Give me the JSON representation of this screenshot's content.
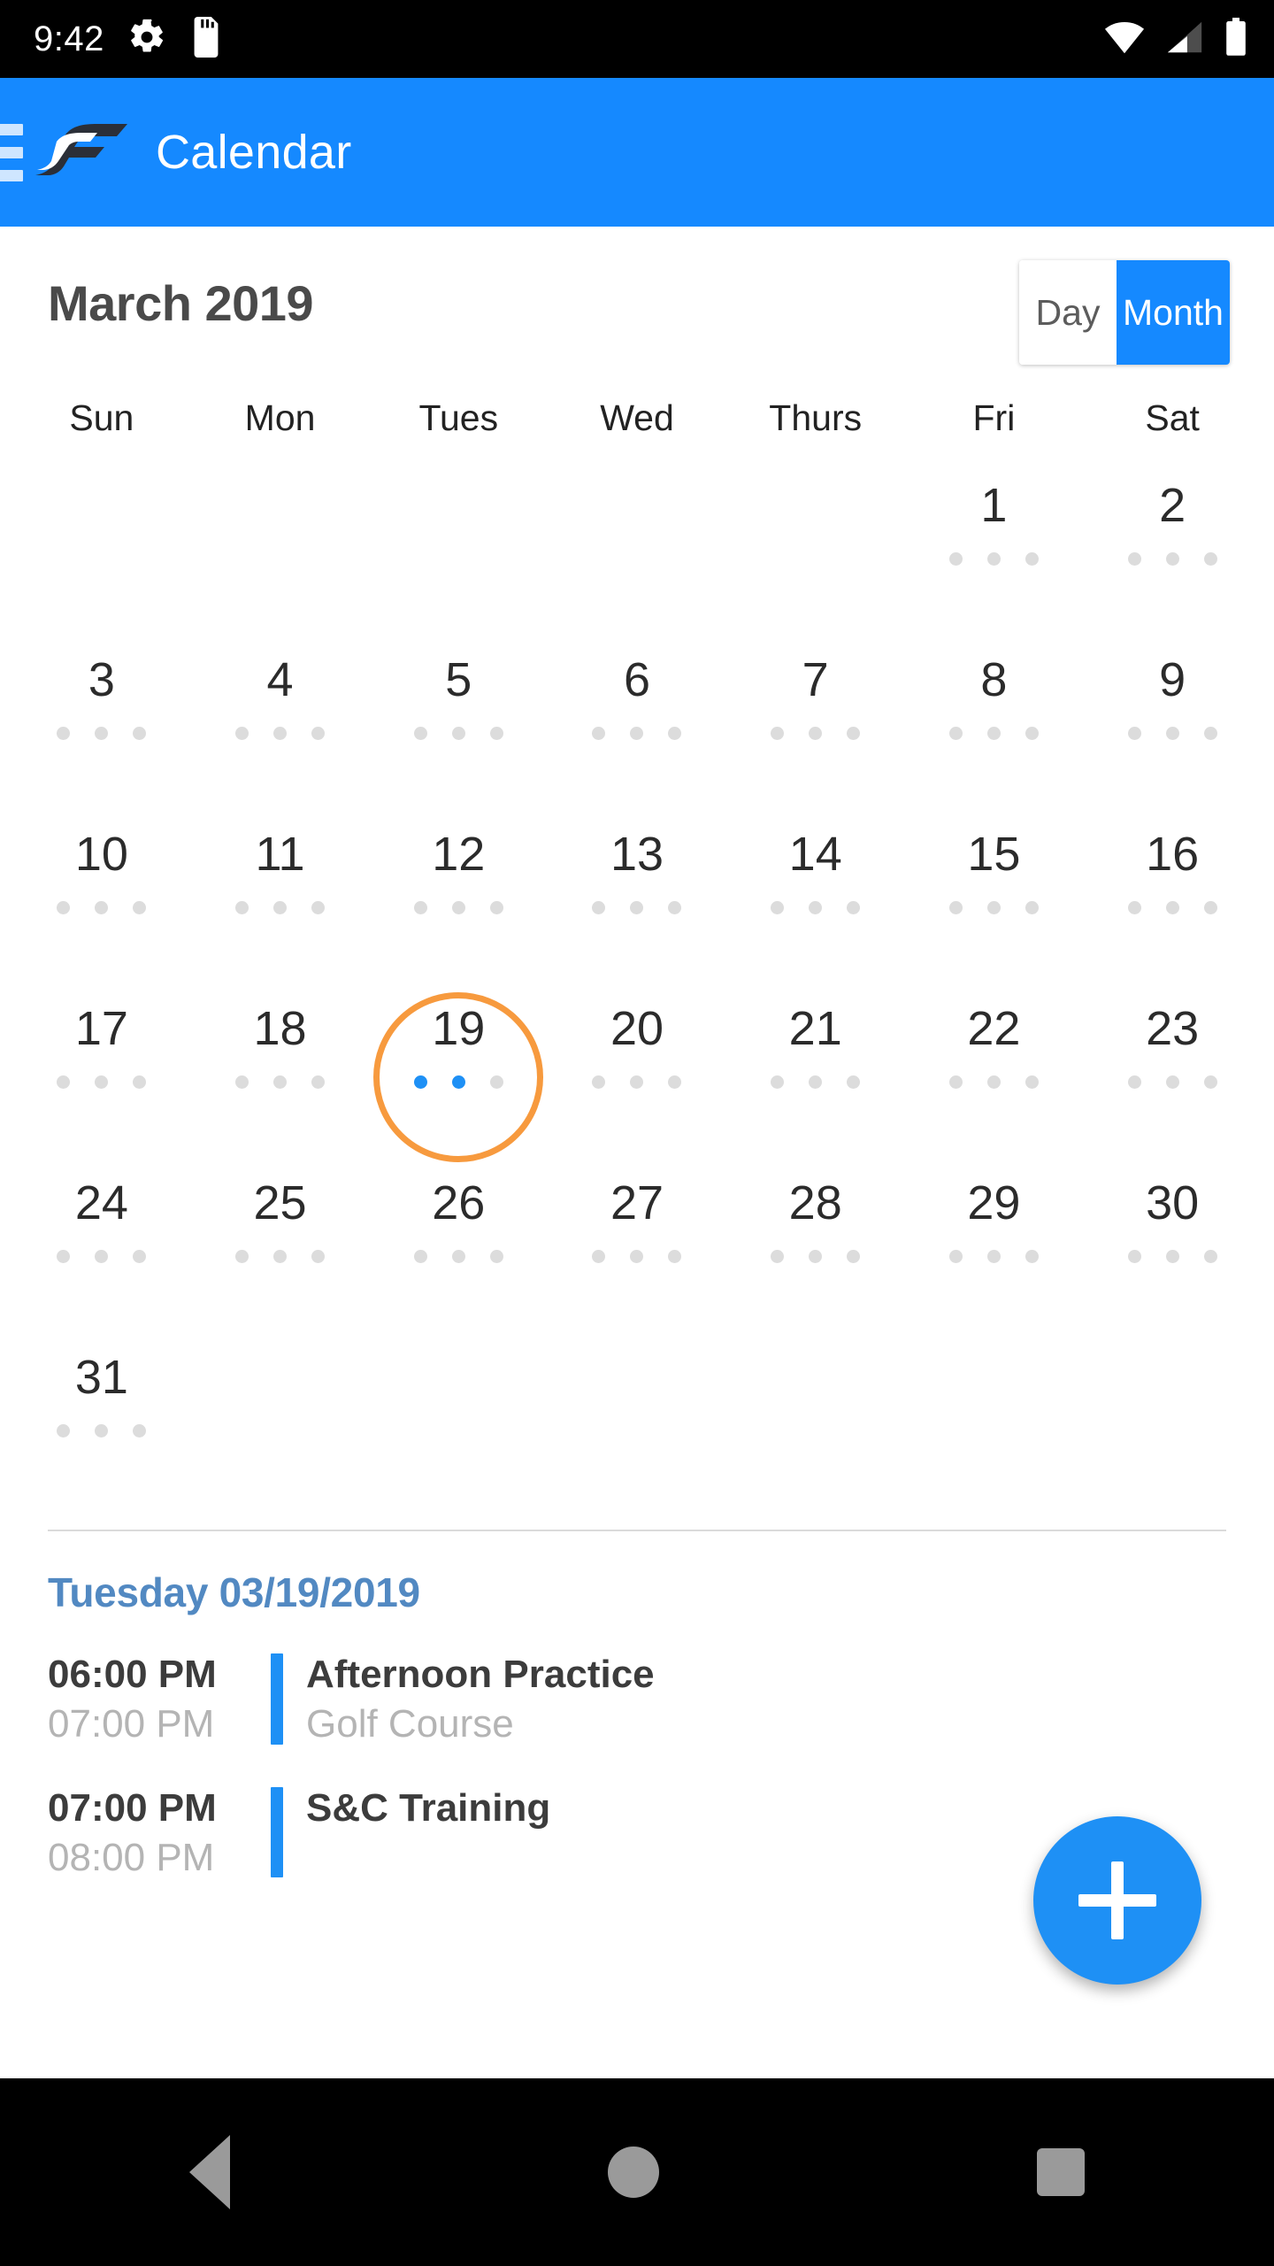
{
  "statusbar": {
    "time": "9:42",
    "icons": [
      "gear-icon",
      "sd-card-icon",
      "wifi-icon",
      "cellular-signal-icon",
      "battery-icon"
    ]
  },
  "appbar": {
    "menu_icon": "hamburger-menu-icon",
    "logo": "sf-logo",
    "title": "Calendar",
    "background_color": "#1589ff"
  },
  "header": {
    "month_title": "March 2019",
    "toggle": {
      "day_label": "Day",
      "month_label": "Month",
      "active": "Month",
      "active_color": "#1589ff"
    }
  },
  "calendar": {
    "weekdays": [
      "Sun",
      "Mon",
      "Tues",
      "Wed",
      "Thurs",
      "Fri",
      "Sat"
    ],
    "leading_blanks": 5,
    "selected_day": 19,
    "selection_ring_color": "#f79a3e",
    "event_dot_color": "#1e90f5",
    "empty_dot_color": "#dcdcdc",
    "days": [
      {
        "day": "1",
        "dots": [
          0,
          0,
          0
        ]
      },
      {
        "day": "2",
        "dots": [
          0,
          0,
          0
        ]
      },
      {
        "day": "3",
        "dots": [
          0,
          0,
          0
        ]
      },
      {
        "day": "4",
        "dots": [
          0,
          0,
          0
        ]
      },
      {
        "day": "5",
        "dots": [
          0,
          0,
          0
        ]
      },
      {
        "day": "6",
        "dots": [
          0,
          0,
          0
        ]
      },
      {
        "day": "7",
        "dots": [
          0,
          0,
          0
        ]
      },
      {
        "day": "8",
        "dots": [
          0,
          0,
          0
        ]
      },
      {
        "day": "9",
        "dots": [
          0,
          0,
          0
        ]
      },
      {
        "day": "10",
        "dots": [
          0,
          0,
          0
        ]
      },
      {
        "day": "11",
        "dots": [
          0,
          0,
          0
        ]
      },
      {
        "day": "12",
        "dots": [
          0,
          0,
          0
        ]
      },
      {
        "day": "13",
        "dots": [
          0,
          0,
          0
        ]
      },
      {
        "day": "14",
        "dots": [
          0,
          0,
          0
        ]
      },
      {
        "day": "15",
        "dots": [
          0,
          0,
          0
        ]
      },
      {
        "day": "16",
        "dots": [
          0,
          0,
          0
        ]
      },
      {
        "day": "17",
        "dots": [
          0,
          0,
          0
        ]
      },
      {
        "day": "18",
        "dots": [
          0,
          0,
          0
        ]
      },
      {
        "day": "19",
        "dots": [
          1,
          1,
          0
        ],
        "selected": true
      },
      {
        "day": "20",
        "dots": [
          0,
          0,
          0
        ]
      },
      {
        "day": "21",
        "dots": [
          0,
          0,
          0
        ]
      },
      {
        "day": "22",
        "dots": [
          0,
          0,
          0
        ]
      },
      {
        "day": "23",
        "dots": [
          0,
          0,
          0
        ]
      },
      {
        "day": "24",
        "dots": [
          0,
          0,
          0
        ]
      },
      {
        "day": "25",
        "dots": [
          0,
          0,
          0
        ]
      },
      {
        "day": "26",
        "dots": [
          0,
          0,
          0
        ]
      },
      {
        "day": "27",
        "dots": [
          0,
          0,
          0
        ]
      },
      {
        "day": "28",
        "dots": [
          0,
          0,
          0
        ]
      },
      {
        "day": "29",
        "dots": [
          0,
          0,
          0
        ]
      },
      {
        "day": "30",
        "dots": [
          0,
          0,
          0
        ]
      },
      {
        "day": "31",
        "dots": [
          0,
          0,
          0
        ]
      }
    ]
  },
  "agenda": {
    "date_heading": "Tuesday 03/19/2019",
    "date_heading_color": "#5289c2",
    "accent_bar_color": "#1e90f5",
    "events": [
      {
        "start_time": "06:00 PM",
        "end_time": "07:00 PM",
        "title": "Afternoon Practice",
        "location": "Golf Course"
      },
      {
        "start_time": "07:00 PM",
        "end_time": "08:00 PM",
        "title": "S&C Training",
        "location": ""
      }
    ]
  },
  "fab": {
    "icon": "plus-icon",
    "color": "#1e90f5"
  },
  "navbar": {
    "buttons": [
      "back-button",
      "home-button",
      "recents-button"
    ]
  }
}
